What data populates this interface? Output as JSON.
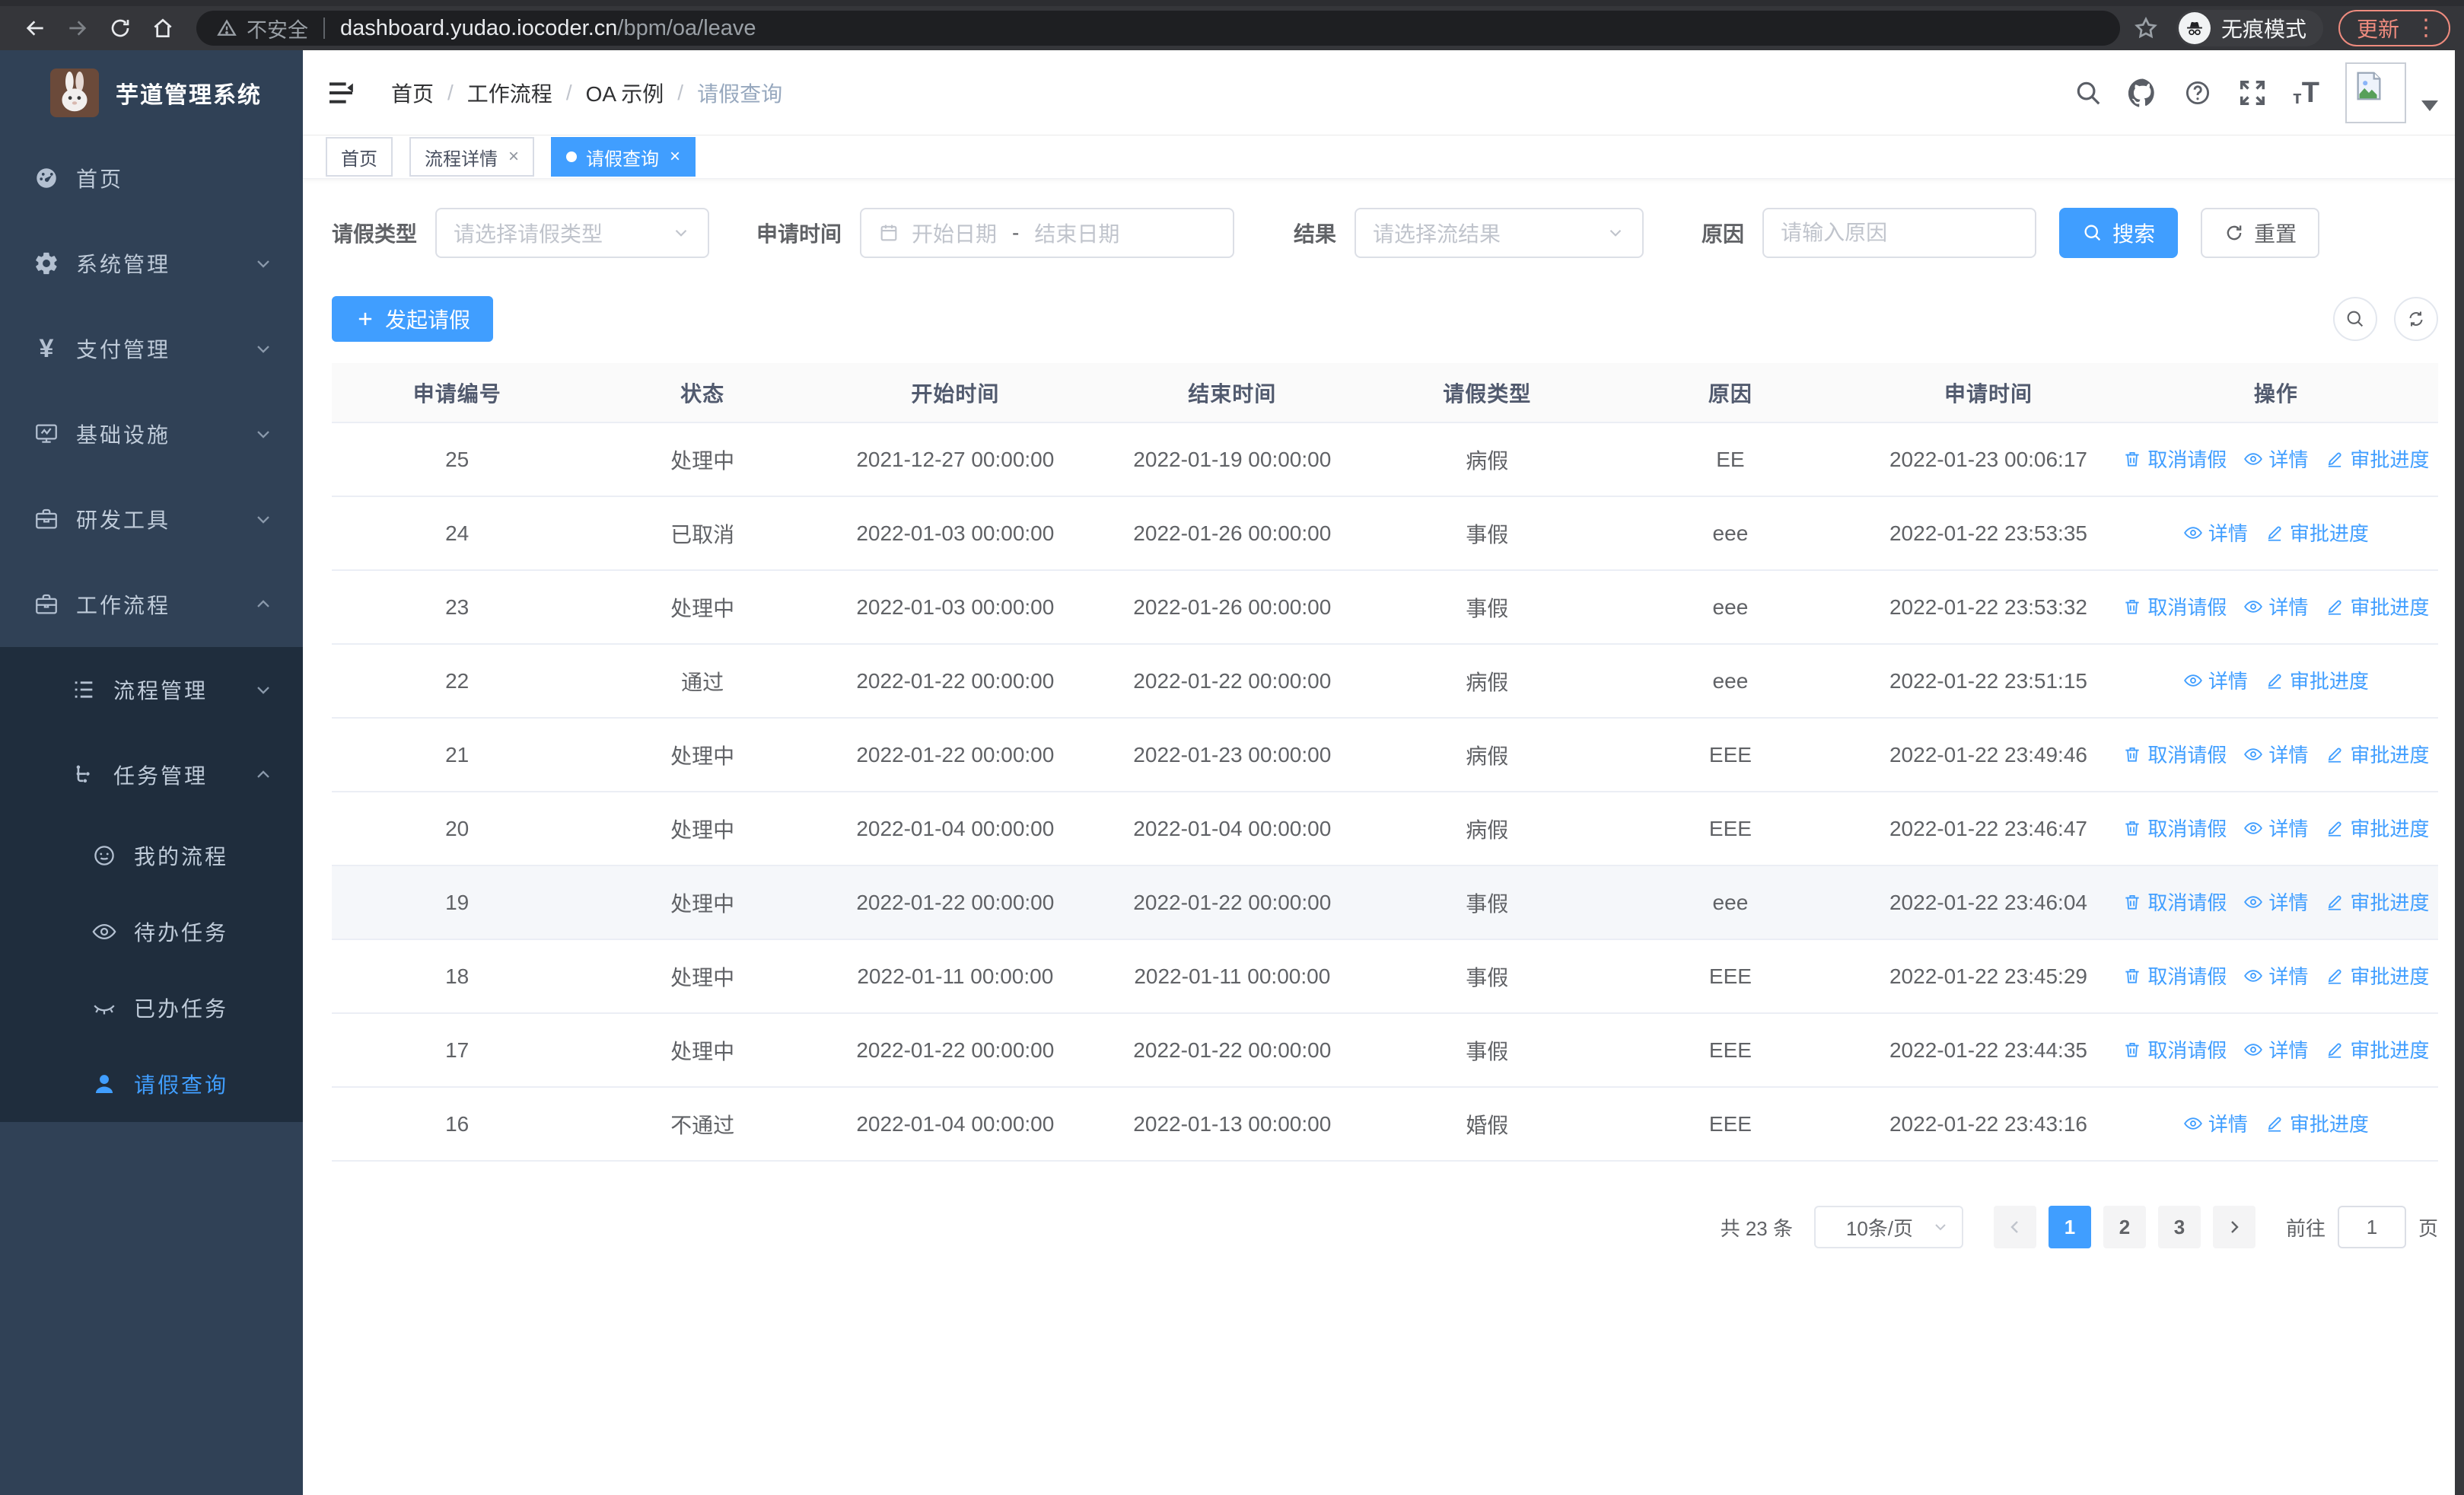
{
  "browser": {
    "security_label": "不安全",
    "url_host": "dashboard.yudao.iocoder.cn",
    "url_path": "/bpm/oa/leave",
    "incognito_label": "无痕模式",
    "update_label": "更新",
    "accent_color": "#ee8b7e"
  },
  "sidebar": {
    "title": "芋道管理系统",
    "active_color": "#409eff",
    "menu": [
      {
        "label": "首页",
        "icon": "dashboard-icon",
        "level": 1
      },
      {
        "label": "系统管理",
        "icon": "gear-icon",
        "level": 1,
        "chevron": "down"
      },
      {
        "label": "支付管理",
        "icon": "yen-icon",
        "level": 1,
        "chevron": "down"
      },
      {
        "label": "基础设施",
        "icon": "monitor-icon",
        "level": 1,
        "chevron": "down"
      },
      {
        "label": "研发工具",
        "icon": "toolbox-icon",
        "level": 1,
        "chevron": "down"
      },
      {
        "label": "工作流程",
        "icon": "briefcase-icon",
        "level": 1,
        "chevron": "up"
      },
      {
        "label": "流程管理",
        "icon": "list-icon",
        "level": 2,
        "chevron": "down",
        "submenu": true
      },
      {
        "label": "任务管理",
        "icon": "flow-icon",
        "level": 2,
        "chevron": "up",
        "submenu": true
      },
      {
        "label": "我的流程",
        "icon": "face-icon",
        "level": 3,
        "submenu": true
      },
      {
        "label": "待办任务",
        "icon": "eye-open-icon",
        "level": 3,
        "submenu": true
      },
      {
        "label": "已办任务",
        "icon": "eye-closed-icon",
        "level": 3,
        "submenu": true
      },
      {
        "label": "请假查询",
        "icon": "user-icon",
        "level": 3,
        "submenu": true,
        "active": true
      }
    ]
  },
  "breadcrumb": {
    "separator": "/",
    "items": [
      "首页",
      "工作流程",
      "OA 示例",
      "请假查询"
    ]
  },
  "tabs": [
    {
      "label": "首页",
      "closable": false,
      "active": false
    },
    {
      "label": "流程详情",
      "closable": true,
      "active": false
    },
    {
      "label": "请假查询",
      "closable": true,
      "active": true
    }
  ],
  "filters": {
    "leave_type": {
      "label": "请假类型",
      "placeholder": "请选择请假类型"
    },
    "apply_time": {
      "label": "申请时间",
      "start_placeholder": "开始日期",
      "separator": "-",
      "end_placeholder": "结束日期"
    },
    "result": {
      "label": "结果",
      "placeholder": "请选择流结果"
    },
    "reason": {
      "label": "原因",
      "placeholder": "请输入原因"
    },
    "search_label": "搜索",
    "reset_label": "重置"
  },
  "toolbar": {
    "create_label": "发起请假"
  },
  "table": {
    "columns": [
      {
        "key": "id",
        "label": "申请编号"
      },
      {
        "key": "status",
        "label": "状态"
      },
      {
        "key": "start_time",
        "label": "开始时间"
      },
      {
        "key": "end_time",
        "label": "结束时间"
      },
      {
        "key": "leave_type",
        "label": "请假类型"
      },
      {
        "key": "reason",
        "label": "原因"
      },
      {
        "key": "apply_time",
        "label": "申请时间"
      },
      {
        "key": "actions",
        "label": "操作"
      }
    ],
    "rows": [
      {
        "id": "25",
        "status": "处理中",
        "start_time": "2021-12-27 00:00:00",
        "end_time": "2022-01-19 00:00:00",
        "leave_type": "病假",
        "reason": "EE",
        "apply_time": "2022-01-23 00:06:17",
        "actions": [
          {
            "label": "取消请假",
            "icon": "delete-icon"
          },
          {
            "label": "详情",
            "icon": "view-icon"
          },
          {
            "label": "审批进度",
            "icon": "edit-icon"
          }
        ]
      },
      {
        "id": "24",
        "status": "已取消",
        "start_time": "2022-01-03 00:00:00",
        "end_time": "2022-01-26 00:00:00",
        "leave_type": "事假",
        "reason": "eee",
        "apply_time": "2022-01-22 23:53:35",
        "actions": [
          {
            "label": "详情",
            "icon": "view-icon"
          },
          {
            "label": "审批进度",
            "icon": "edit-icon"
          }
        ]
      },
      {
        "id": "23",
        "status": "处理中",
        "start_time": "2022-01-03 00:00:00",
        "end_time": "2022-01-26 00:00:00",
        "leave_type": "事假",
        "reason": "eee",
        "apply_time": "2022-01-22 23:53:32",
        "actions": [
          {
            "label": "取消请假",
            "icon": "delete-icon"
          },
          {
            "label": "详情",
            "icon": "view-icon"
          },
          {
            "label": "审批进度",
            "icon": "edit-icon"
          }
        ]
      },
      {
        "id": "22",
        "status": "通过",
        "start_time": "2022-01-22 00:00:00",
        "end_time": "2022-01-22 00:00:00",
        "leave_type": "病假",
        "reason": "eee",
        "apply_time": "2022-01-22 23:51:15",
        "actions": [
          {
            "label": "详情",
            "icon": "view-icon"
          },
          {
            "label": "审批进度",
            "icon": "edit-icon"
          }
        ]
      },
      {
        "id": "21",
        "status": "处理中",
        "start_time": "2022-01-22 00:00:00",
        "end_time": "2022-01-23 00:00:00",
        "leave_type": "病假",
        "reason": "EEE",
        "apply_time": "2022-01-22 23:49:46",
        "actions": [
          {
            "label": "取消请假",
            "icon": "delete-icon"
          },
          {
            "label": "详情",
            "icon": "view-icon"
          },
          {
            "label": "审批进度",
            "icon": "edit-icon"
          }
        ]
      },
      {
        "id": "20",
        "status": "处理中",
        "start_time": "2022-01-04 00:00:00",
        "end_time": "2022-01-04 00:00:00",
        "leave_type": "病假",
        "reason": "EEE",
        "apply_time": "2022-01-22 23:46:47",
        "actions": [
          {
            "label": "取消请假",
            "icon": "delete-icon"
          },
          {
            "label": "详情",
            "icon": "view-icon"
          },
          {
            "label": "审批进度",
            "icon": "edit-icon"
          }
        ]
      },
      {
        "id": "19",
        "status": "处理中",
        "start_time": "2022-01-22 00:00:00",
        "end_time": "2022-01-22 00:00:00",
        "leave_type": "事假",
        "reason": "eee",
        "apply_time": "2022-01-22 23:46:04",
        "highlighted": true,
        "actions": [
          {
            "label": "取消请假",
            "icon": "delete-icon"
          },
          {
            "label": "详情",
            "icon": "view-icon"
          },
          {
            "label": "审批进度",
            "icon": "edit-icon"
          }
        ]
      },
      {
        "id": "18",
        "status": "处理中",
        "start_time": "2022-01-11 00:00:00",
        "end_time": "2022-01-11 00:00:00",
        "leave_type": "事假",
        "reason": "EEE",
        "apply_time": "2022-01-22 23:45:29",
        "actions": [
          {
            "label": "取消请假",
            "icon": "delete-icon"
          },
          {
            "label": "详情",
            "icon": "view-icon"
          },
          {
            "label": "审批进度",
            "icon": "edit-icon"
          }
        ]
      },
      {
        "id": "17",
        "status": "处理中",
        "start_time": "2022-01-22 00:00:00",
        "end_time": "2022-01-22 00:00:00",
        "leave_type": "事假",
        "reason": "EEE",
        "apply_time": "2022-01-22 23:44:35",
        "actions": [
          {
            "label": "取消请假",
            "icon": "delete-icon"
          },
          {
            "label": "详情",
            "icon": "view-icon"
          },
          {
            "label": "审批进度",
            "icon": "edit-icon"
          }
        ]
      },
      {
        "id": "16",
        "status": "不通过",
        "start_time": "2022-01-04 00:00:00",
        "end_time": "2022-01-13 00:00:00",
        "leave_type": "婚假",
        "reason": "EEE",
        "apply_time": "2022-01-22 23:43:16",
        "actions": [
          {
            "label": "详情",
            "icon": "view-icon"
          },
          {
            "label": "审批进度",
            "icon": "edit-icon"
          }
        ]
      }
    ]
  },
  "pagination": {
    "total": "共 23 条",
    "page_size": "10条/页",
    "pages": [
      "1",
      "2",
      "3"
    ],
    "active_page": "1",
    "goto_label": "前往",
    "goto_value": "1",
    "goto_suffix": "页"
  }
}
